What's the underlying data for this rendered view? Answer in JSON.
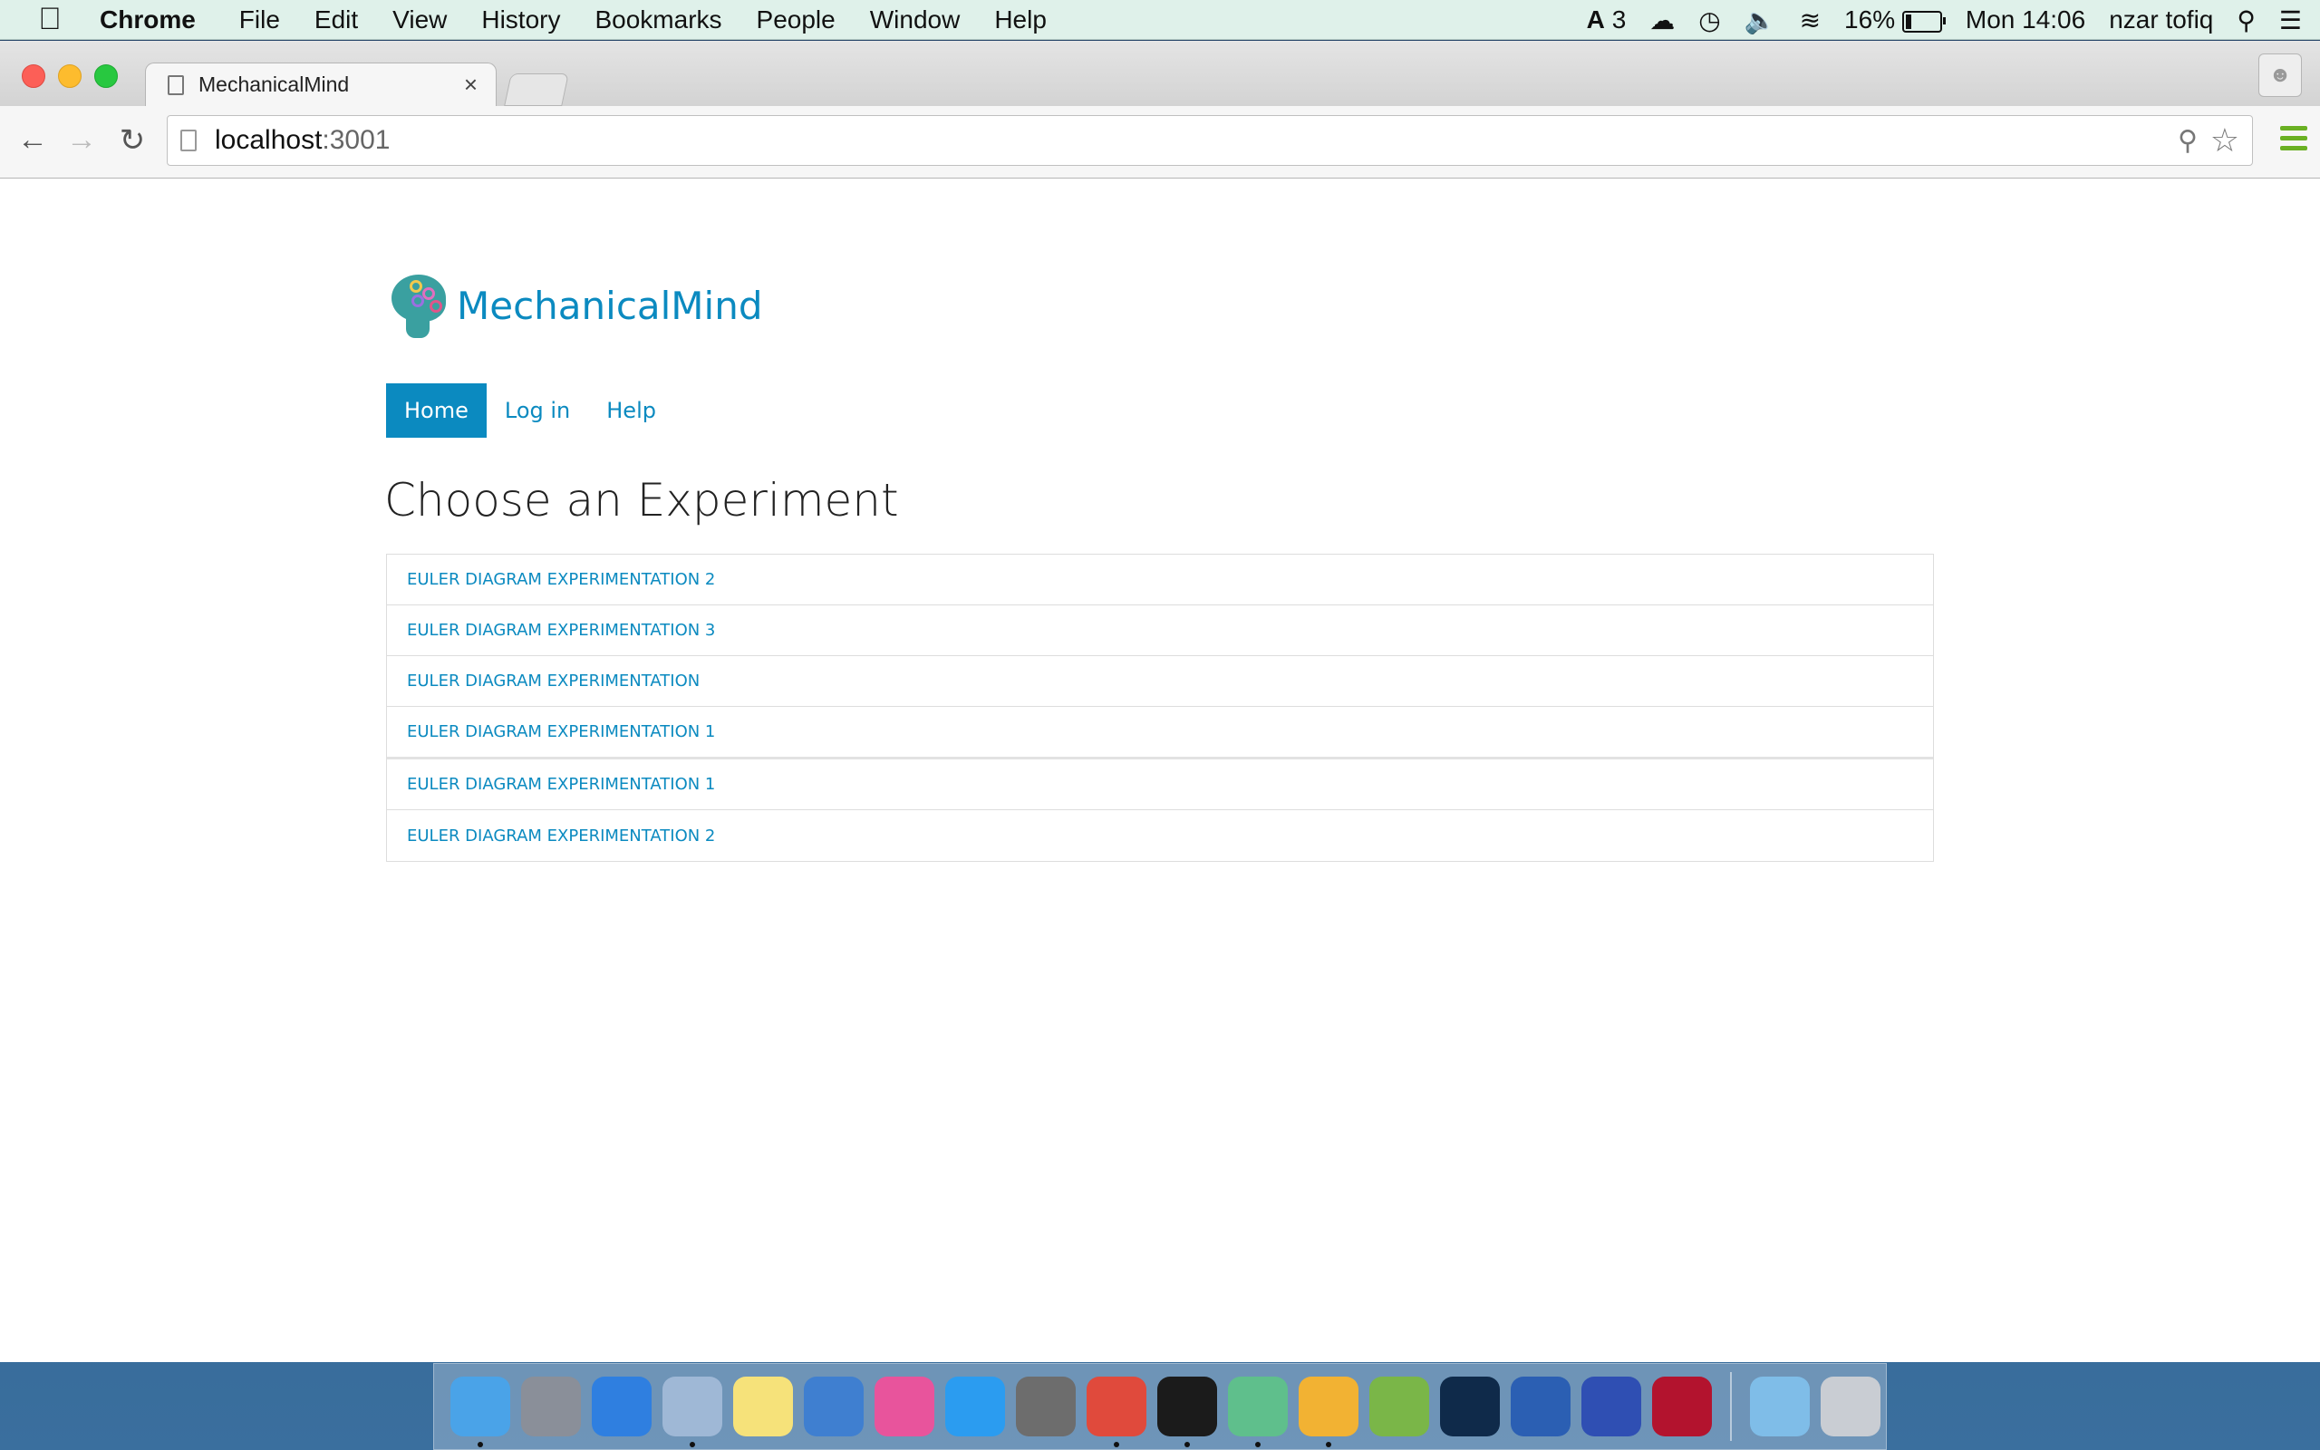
{
  "menubar": {
    "app_name": "Chrome",
    "menus": [
      "File",
      "Edit",
      "View",
      "History",
      "Bookmarks",
      "People",
      "Window",
      "Help"
    ],
    "adobe_count": "3",
    "battery_percent": "16%",
    "battery_level": 0.16,
    "clock": "Mon 14:06",
    "user": "nzar tofiq"
  },
  "browser": {
    "tab_title": "MechanicalMind",
    "url_host": "localhost",
    "url_port": ":3001"
  },
  "site": {
    "brand": "MechanicalMind",
    "nav": [
      {
        "label": "Home",
        "active": true
      },
      {
        "label": "Log in",
        "active": false
      },
      {
        "label": "Help",
        "active": false
      }
    ],
    "heading": "Choose an Experiment",
    "experiments": [
      "EULER DIAGRAM EXPERIMENTATION 2",
      "EULER DIAGRAM EXPERIMENTATION 3",
      "EULER DIAGRAM EXPERIMENTATION",
      "EULER DIAGRAM EXPERIMENTATION 1",
      "EULER DIAGRAM EXPERIMENTATION 1",
      "EULER DIAGRAM EXPERIMENTATION 2"
    ]
  },
  "colors": {
    "link": "#0b8ac0",
    "nav_active_bg": "#0b8ac0",
    "menubar_bg": "#dff1ea"
  },
  "dock": {
    "apps": [
      {
        "name": "finder-icon",
        "color": "#4aa3e8",
        "running": true
      },
      {
        "name": "launchpad-icon",
        "color": "#8a8f99",
        "running": false
      },
      {
        "name": "safari-icon",
        "color": "#2f7fe0",
        "running": false
      },
      {
        "name": "mail-icon",
        "color": "#9fb8d6",
        "running": true
      },
      {
        "name": "notes-icon",
        "color": "#f6e27a",
        "running": false
      },
      {
        "name": "keynote-icon",
        "color": "#3f7fd0",
        "running": false
      },
      {
        "name": "itunes-icon",
        "color": "#e8549c",
        "running": false
      },
      {
        "name": "app-store-icon",
        "color": "#2b9cf0",
        "running": false
      },
      {
        "name": "system-preferences-icon",
        "color": "#6d6d6d",
        "running": false
      },
      {
        "name": "chrome-icon",
        "color": "#e04a3c",
        "running": true
      },
      {
        "name": "terminal-icon",
        "color": "#1b1b1b",
        "running": true
      },
      {
        "name": "atom-icon",
        "color": "#5fbf8c",
        "running": true
      },
      {
        "name": "chrome-canary-icon",
        "color": "#f2b233",
        "running": true
      },
      {
        "name": "android-studio-icon",
        "color": "#7ab648",
        "running": false
      },
      {
        "name": "photoshop-icon",
        "color": "#0f2a4a",
        "running": false
      },
      {
        "name": "word-icon",
        "color": "#2b5fb3",
        "running": false
      },
      {
        "name": "cyberduck-icon",
        "color": "#2f4fb3",
        "running": false
      },
      {
        "name": "mendeley-icon",
        "color": "#b3132e",
        "running": false
      }
    ],
    "stack": [
      {
        "name": "downloads-folder-icon",
        "color": "#7fbde8"
      },
      {
        "name": "trash-icon",
        "color": "#c9cdd3"
      }
    ]
  }
}
